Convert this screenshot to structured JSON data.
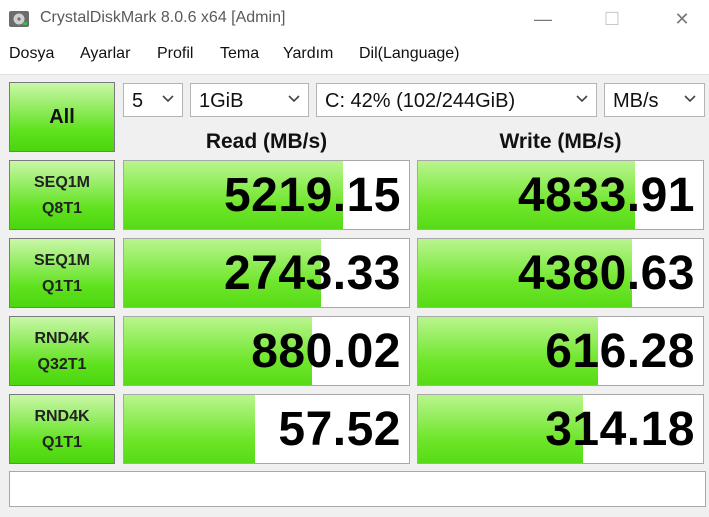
{
  "window": {
    "title": "CrystalDiskMark 8.0.6 x64 [Admin]",
    "minimize": "—",
    "maximize": "☐",
    "close": "✕"
  },
  "menu": [
    "Dosya",
    "Ayarlar",
    "Profil",
    "Tema",
    "Yardım",
    "Dil(Language)"
  ],
  "controls": {
    "all_label": "All",
    "count": "5",
    "size": "1GiB",
    "drive": "C: 42% (102/244GiB)",
    "unit": "MB/s"
  },
  "headers": {
    "read": "Read (MB/s)",
    "write": "Write (MB/s)"
  },
  "rows": [
    {
      "line1": "SEQ1M",
      "line2": "Q8T1",
      "read": "5219.15",
      "write": "4833.91",
      "read_fill": 0.77,
      "write_fill": 0.76
    },
    {
      "line1": "SEQ1M",
      "line2": "Q1T1",
      "read": "2743.33",
      "write": "4380.63",
      "read_fill": 0.69,
      "write_fill": 0.75
    },
    {
      "line1": "RND4K",
      "line2": "Q32T1",
      "read": "880.02",
      "write": "616.28",
      "read_fill": 0.66,
      "write_fill": 0.63
    },
    {
      "line1": "RND4K",
      "line2": "Q1T1",
      "read": "57.52",
      "write": "314.18",
      "read_fill": 0.46,
      "write_fill": 0.58
    }
  ],
  "status_text": "",
  "colors": {
    "accent_green": "#5fe21d",
    "bar_green": "#6ee62a"
  }
}
